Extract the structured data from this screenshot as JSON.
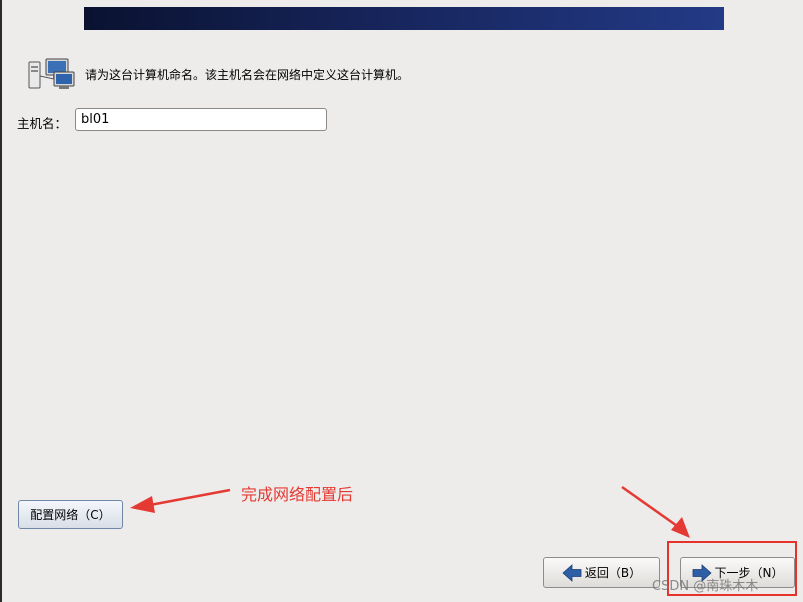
{
  "header": {
    "banner_color": "#16245a"
  },
  "prompt": {
    "icon": "networked-computers-icon",
    "text": "请为这台计算机命名。该主机名会在网络中定义这台计算机。"
  },
  "hostname": {
    "label": "主机名：",
    "value": "bl01"
  },
  "buttons": {
    "configure_network": "配置网络（C）",
    "back": "返回（B）",
    "next": "下一步（N）"
  },
  "annotation": {
    "text": "完成网络配置后",
    "color": "#e53a33"
  },
  "watermark": "CSDN @南珠木木"
}
